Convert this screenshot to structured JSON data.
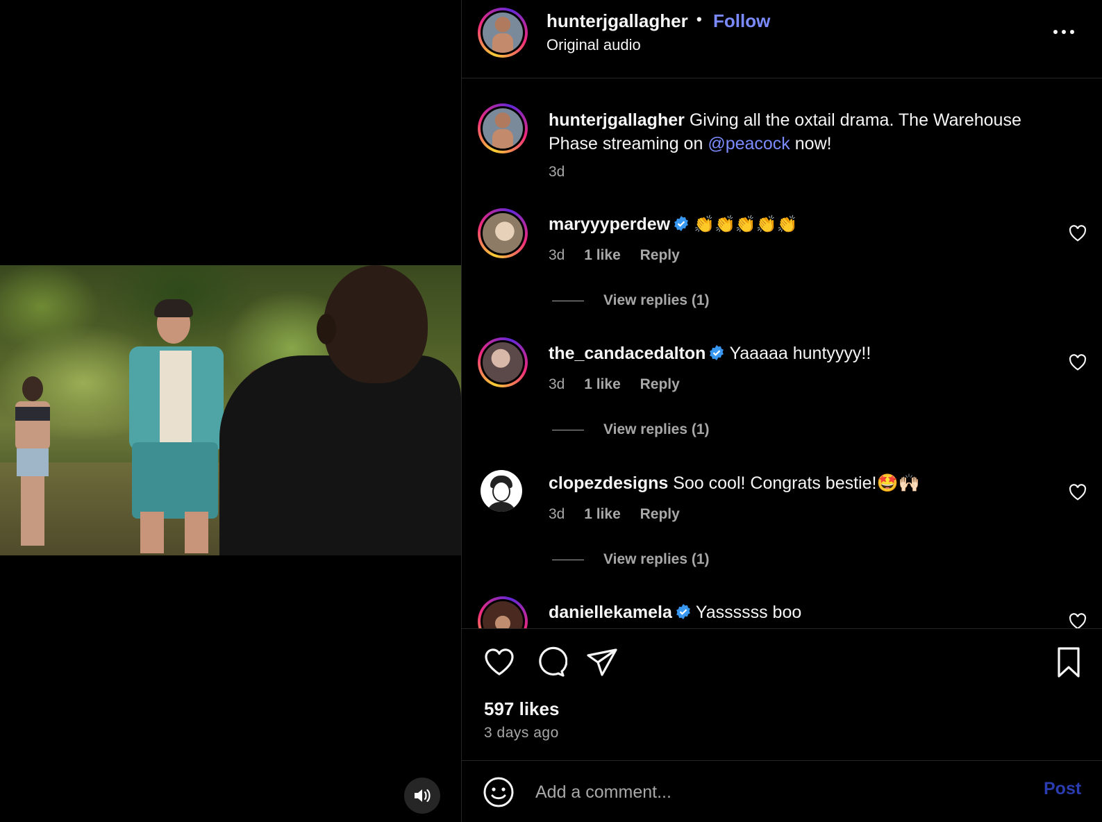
{
  "post": {
    "username": "hunterjgallagher",
    "separator": "•",
    "follow_label": "Follow",
    "audio": "Original audio"
  },
  "caption": {
    "username": "hunterjgallagher",
    "text_before": "Giving all the oxtail drama. The Warehouse",
    "text_line2_before": "Phase streaming on",
    "mention": "@peacock",
    "text_after": "now!",
    "time": "3d"
  },
  "comments": [
    {
      "username": "maryyyperdew",
      "verified": true,
      "text": "👏👏👏👏👏",
      "time": "3d",
      "likes": "1 like",
      "reply_label": "Reply",
      "view_replies": "View replies (1)"
    },
    {
      "username": "the_candacedalton",
      "verified": true,
      "text": "Yaaaaa huntyyyy!!",
      "time": "3d",
      "likes": "1 like",
      "reply_label": "Reply",
      "view_replies": "View replies (1)"
    },
    {
      "username": "clopezdesigns",
      "verified": false,
      "text": "Soo cool! Congrats bestie!🤩🙌🏻",
      "time": "3d",
      "likes": "1 like",
      "reply_label": "Reply",
      "view_replies": "View replies (1)"
    },
    {
      "username": "daniellekamela",
      "verified": true,
      "text": "Yassssss boo"
    }
  ],
  "stats": {
    "likes": "597 likes",
    "ago": "3 days ago"
  },
  "composer": {
    "placeholder": "Add a comment...",
    "post_label": "Post"
  },
  "colors": {
    "accent": "#7b8bff",
    "post_disabled": "#2b3bb0",
    "verified": "#3897f0",
    "muted_text": "#a8a8a8"
  },
  "icons": {
    "mute": "speaker-icon",
    "more": "more-options-icon",
    "like": "heart-icon",
    "comment": "comment-bubble-icon",
    "share": "paper-plane-icon",
    "save": "bookmark-icon",
    "emoji": "smiley-icon"
  }
}
